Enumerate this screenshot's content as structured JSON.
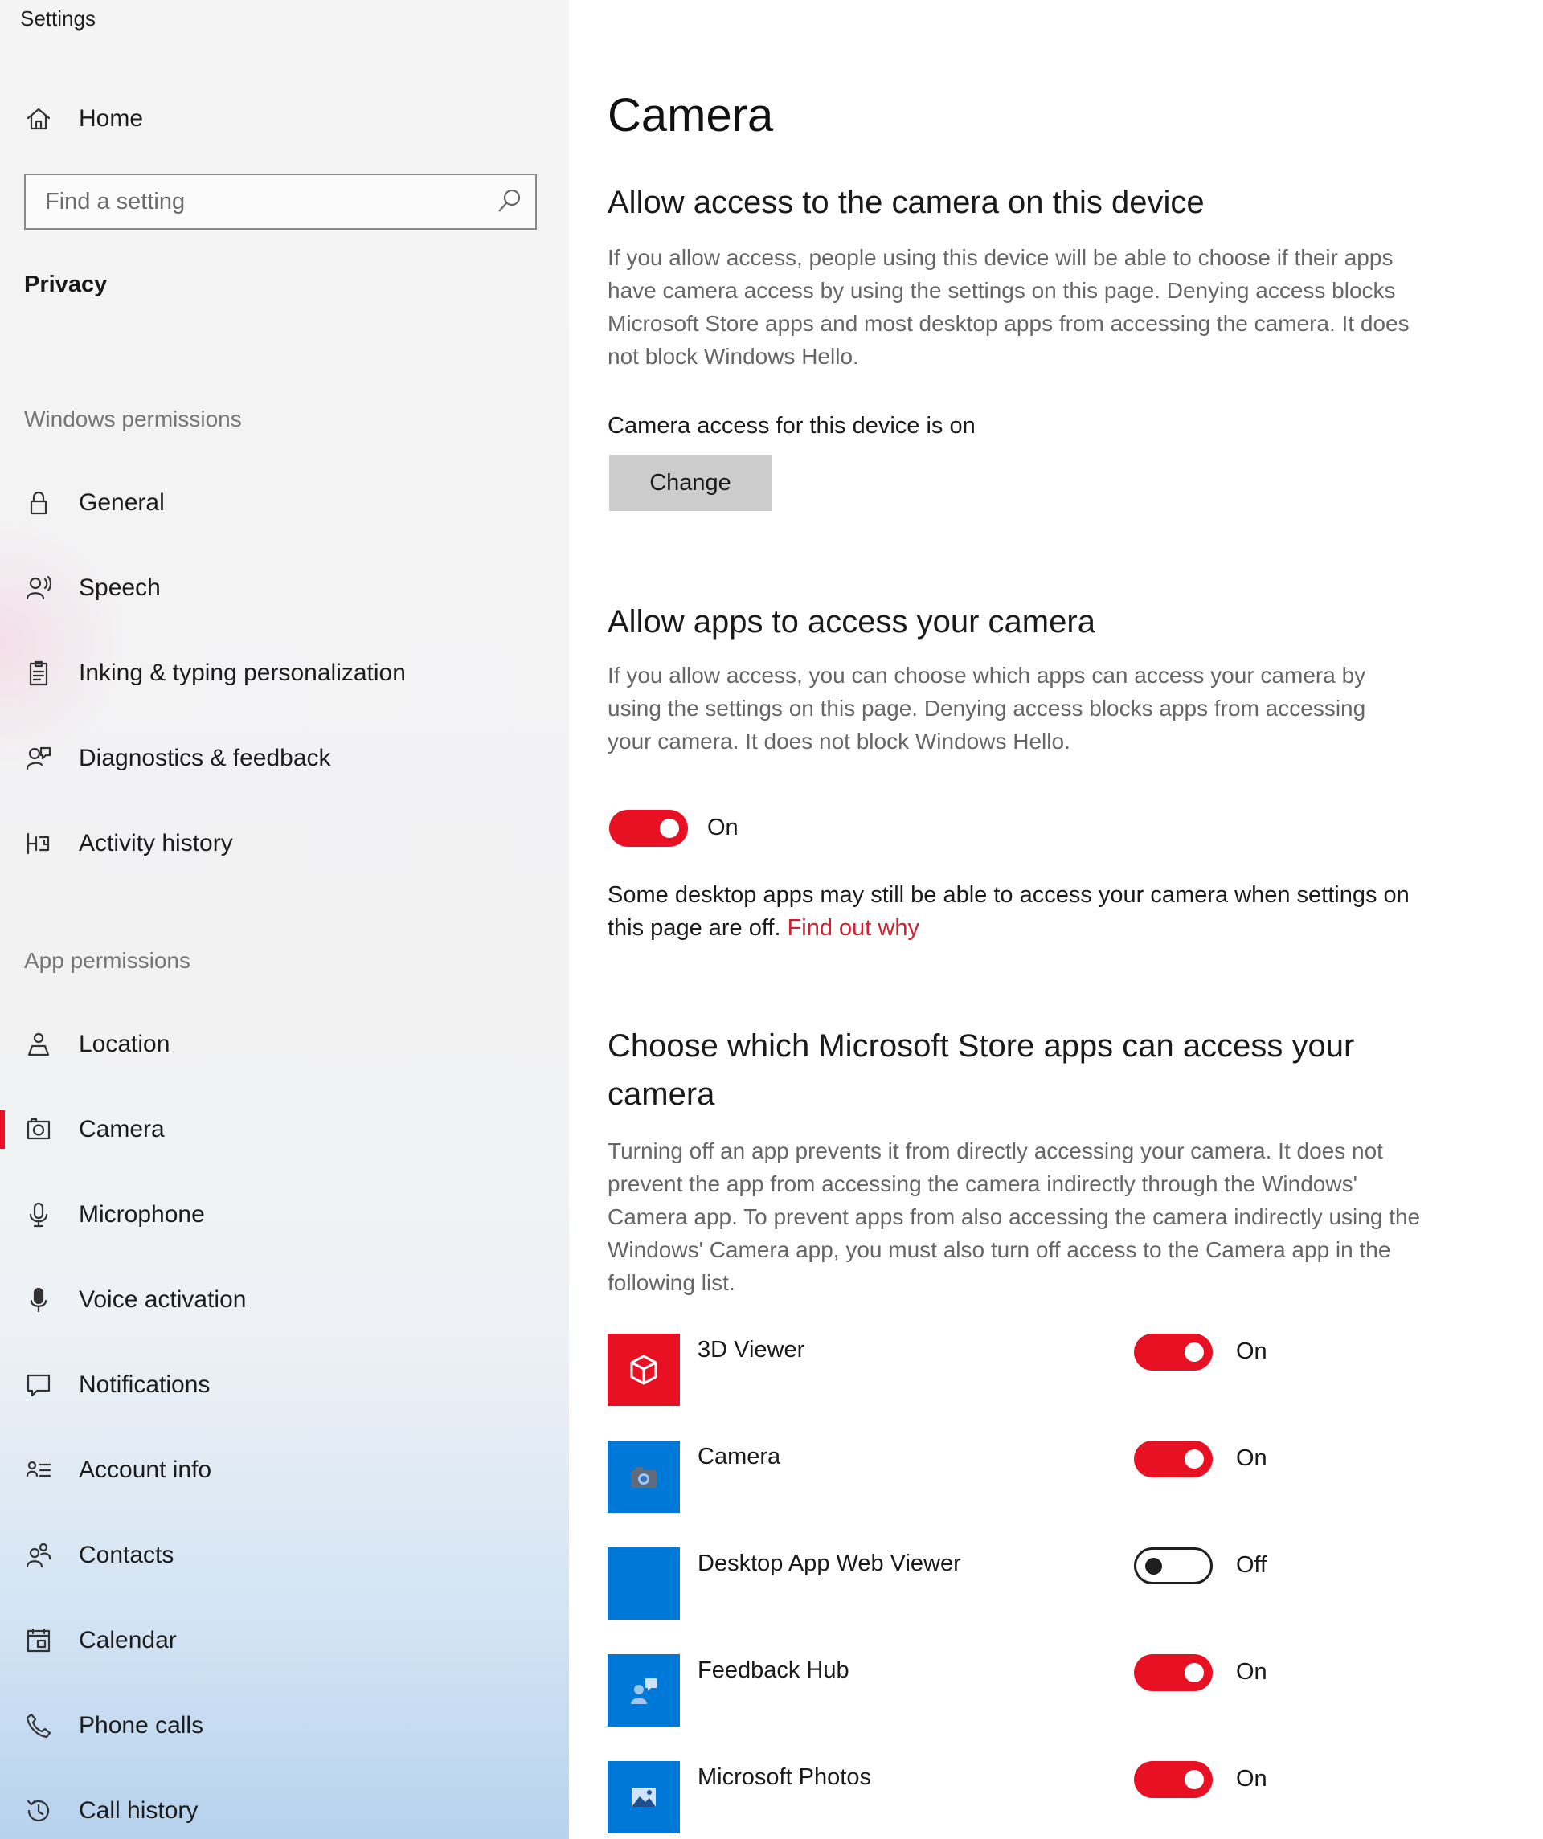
{
  "window": {
    "title": "Settings"
  },
  "sidebar": {
    "home_label": "Home",
    "search_placeholder": "Find a setting",
    "category": "Privacy",
    "windows_permissions_header": "Windows permissions",
    "windows_permissions": [
      {
        "label": "General",
        "icon": "lock-icon"
      },
      {
        "label": "Speech",
        "icon": "speech-icon"
      },
      {
        "label": "Inking & typing personalization",
        "icon": "inking-icon"
      },
      {
        "label": "Diagnostics & feedback",
        "icon": "feedback-icon"
      },
      {
        "label": "Activity history",
        "icon": "activity-icon"
      }
    ],
    "app_permissions_header": "App permissions",
    "app_permissions": [
      {
        "label": "Location",
        "icon": "location-icon"
      },
      {
        "label": "Camera",
        "icon": "camera-icon",
        "selected": true
      },
      {
        "label": "Microphone",
        "icon": "microphone-icon"
      },
      {
        "label": "Voice activation",
        "icon": "voice-icon"
      },
      {
        "label": "Notifications",
        "icon": "notifications-icon"
      },
      {
        "label": "Account info",
        "icon": "account-info-icon"
      },
      {
        "label": "Contacts",
        "icon": "contacts-icon"
      },
      {
        "label": "Calendar",
        "icon": "calendar-icon"
      },
      {
        "label": "Phone calls",
        "icon": "phone-icon"
      },
      {
        "label": "Call history",
        "icon": "history-icon"
      }
    ]
  },
  "main": {
    "title": "Camera",
    "device_section": {
      "heading": "Allow access to the camera on this device",
      "description": "If you allow access, people using this device will be able to choose if their apps have camera access by using the settings on this page. Denying access blocks Microsoft Store apps and most desktop apps from accessing the camera. It does not block Windows Hello.",
      "status": "Camera access for this device is on",
      "button_label": "Change"
    },
    "apps_section": {
      "heading": "Allow apps to access your camera",
      "description": "If you allow access, you can choose which apps can access your camera by using the settings on this page. Denying access blocks apps from accessing your camera. It does not block Windows Hello.",
      "toggle_state": "On",
      "note": "Some desktop apps may still be able to access your camera when settings on this page are off.",
      "link": "Find out why"
    },
    "store_section": {
      "heading": "Choose which Microsoft Store apps can access your camera",
      "description": "Turning off an app prevents it from directly accessing your camera. It does not prevent the app from accessing the camera indirectly through the Windows' Camera app. To prevent apps from also accessing the camera indirectly using the Windows' Camera app, you must also turn off access to the Camera app in the following list.",
      "apps": [
        {
          "name": "3D Viewer",
          "state": "On",
          "tile_color": "#e81123",
          "icon": "cube-icon"
        },
        {
          "name": "Camera",
          "state": "On",
          "tile_color": "#0078d7",
          "icon": "camera-app-icon"
        },
        {
          "name": "Desktop App Web Viewer",
          "state": "Off",
          "tile_color": "#0078d7",
          "icon": "blank-tile-icon"
        },
        {
          "name": "Feedback Hub",
          "state": "On",
          "tile_color": "#0078d7",
          "icon": "feedback-hub-icon"
        },
        {
          "name": "Microsoft Photos",
          "state": "On",
          "tile_color": "#0078d7",
          "icon": "photos-icon"
        }
      ]
    }
  },
  "colors": {
    "accent": "#e81123",
    "link": "#d1202f",
    "tile_blue": "#0078d7"
  }
}
